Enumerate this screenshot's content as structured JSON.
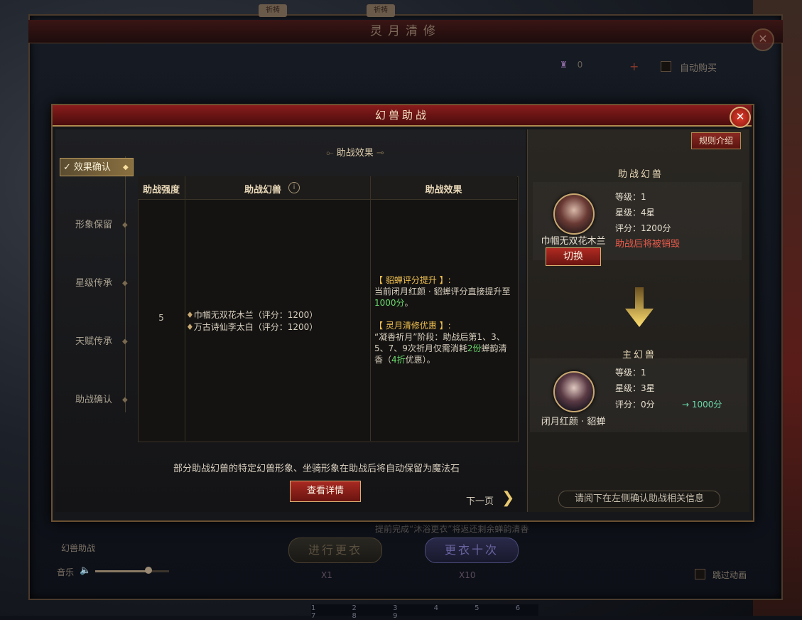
{
  "outer": {
    "title": "灵月清修",
    "tags": [
      "祈祷",
      "祈祷"
    ],
    "currency_value": "0",
    "auto_buy": "自动购买",
    "left_label": "幻兽助战",
    "music_label": "音乐",
    "music_level": 0.72,
    "hint": "提前完成“沐浴更衣”将返还剩余蝉韵清香",
    "btn_once": "进行更衣",
    "btn_ten": "更衣十次",
    "cost_once": "X1",
    "cost_ten": "X10",
    "skip": "跳过动画",
    "hotbar": "1 2 3 4 5 6 7 8 9"
  },
  "dialog": {
    "title": "幻兽助战",
    "nav": [
      "效果确认",
      "形象保留",
      "星级传承",
      "天赋传承",
      "助战确认"
    ],
    "section_title": "助战效果",
    "table": {
      "headers": [
        "助战强度",
        "助战幻兽",
        "助战效果"
      ],
      "strength": "5",
      "beasts": [
        "巾帼无双花木兰（评分：1200）",
        "万古诗仙李太白（评分：1200）"
      ],
      "effect": {
        "t1": "【 貂蝉评分提升 】:",
        "l1a": "当前闭月红颜 · 貂蝉评分直接提升至",
        "l1b": "1000分",
        "l1c": "。",
        "t2": "【 灵月清修优惠 】:",
        "l2a": "“凝香祈月”阶段：助战后第1、3、5、7、9次祈月仅需消耗",
        "l2b": "2份",
        "l2c": "蝉韵清香（",
        "l2d": "4折",
        "l2e": "优惠）。"
      }
    },
    "note": "部分助战幻兽的特定幻兽形象、坐骑形象在助战后将自动保留为魔法石",
    "detail_btn": "查看详情",
    "next_page": "下一页"
  },
  "right": {
    "rules_btn": "规则介绍",
    "assist_label": "助战幻兽",
    "assist": {
      "name": "巾帼无双花木兰",
      "level": "等级：1",
      "stars": "星级：4星",
      "score": "评分：1200分",
      "destroy": "助战后将被销毁",
      "switch_btn": "切换"
    },
    "main_label": "主幻兽",
    "main": {
      "name": "闭月红颜 · 貂蝉",
      "level": "等级：1",
      "stars": "星级：3星",
      "score": "评分：0分",
      "score_after": "→ 1000分"
    },
    "confirm_hint": "请阅下在左侧确认助战相关信息"
  },
  "colors": {
    "accent_red": "#8a1c1c",
    "gold": "#c8a870",
    "green": "#6ad86a",
    "warn": "#e85a4a"
  }
}
